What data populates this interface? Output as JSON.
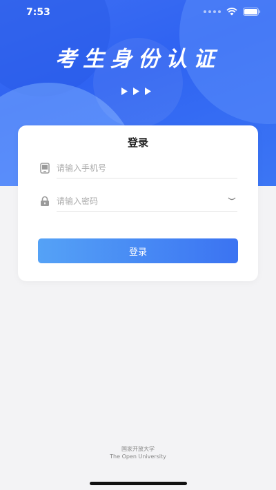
{
  "status_bar": {
    "time": "7:53"
  },
  "header": {
    "title": "考生身份认证"
  },
  "login_card": {
    "title": "登录",
    "phone_placeholder": "请输入手机号",
    "password_placeholder": "请输入密码",
    "submit_label": "登录"
  },
  "footer": {
    "line1": "国家开放大学",
    "line2": "The Open University"
  },
  "colors": {
    "header_blue": "#2f63f2",
    "button_start": "#55a2f6",
    "button_end": "#3b73f2"
  }
}
